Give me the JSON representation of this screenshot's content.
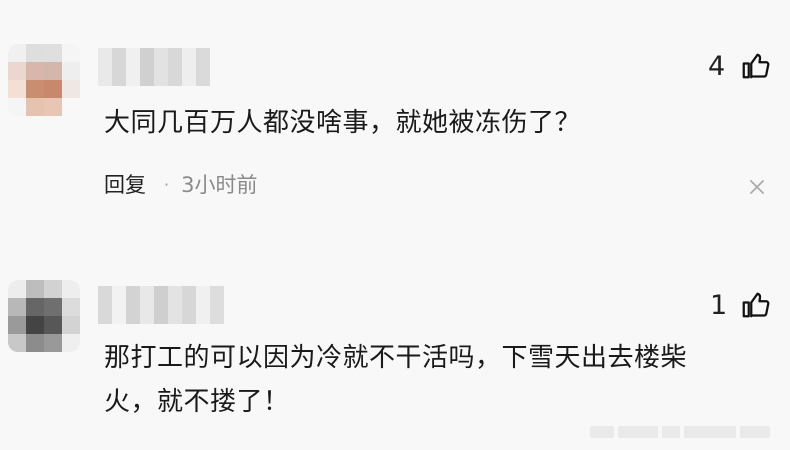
{
  "comments": [
    {
      "text": "大同几百万人都没啥事，就她被冻伤了？",
      "likes": "4",
      "reply_label": "回复",
      "separator": "·",
      "time": "3小时前",
      "like_icon": "thumbs-up-icon",
      "dismiss_icon": "close-icon"
    },
    {
      "text": "那打工的可以因为冷就不干活吗，下雪天出去楼柴火，就不搂了！",
      "likes": "1",
      "like_icon": "thumbs-up-icon"
    }
  ],
  "colors": {
    "background": "#f8f8f8",
    "text": "#1a1a1a",
    "meta": "#8a8a8a"
  }
}
